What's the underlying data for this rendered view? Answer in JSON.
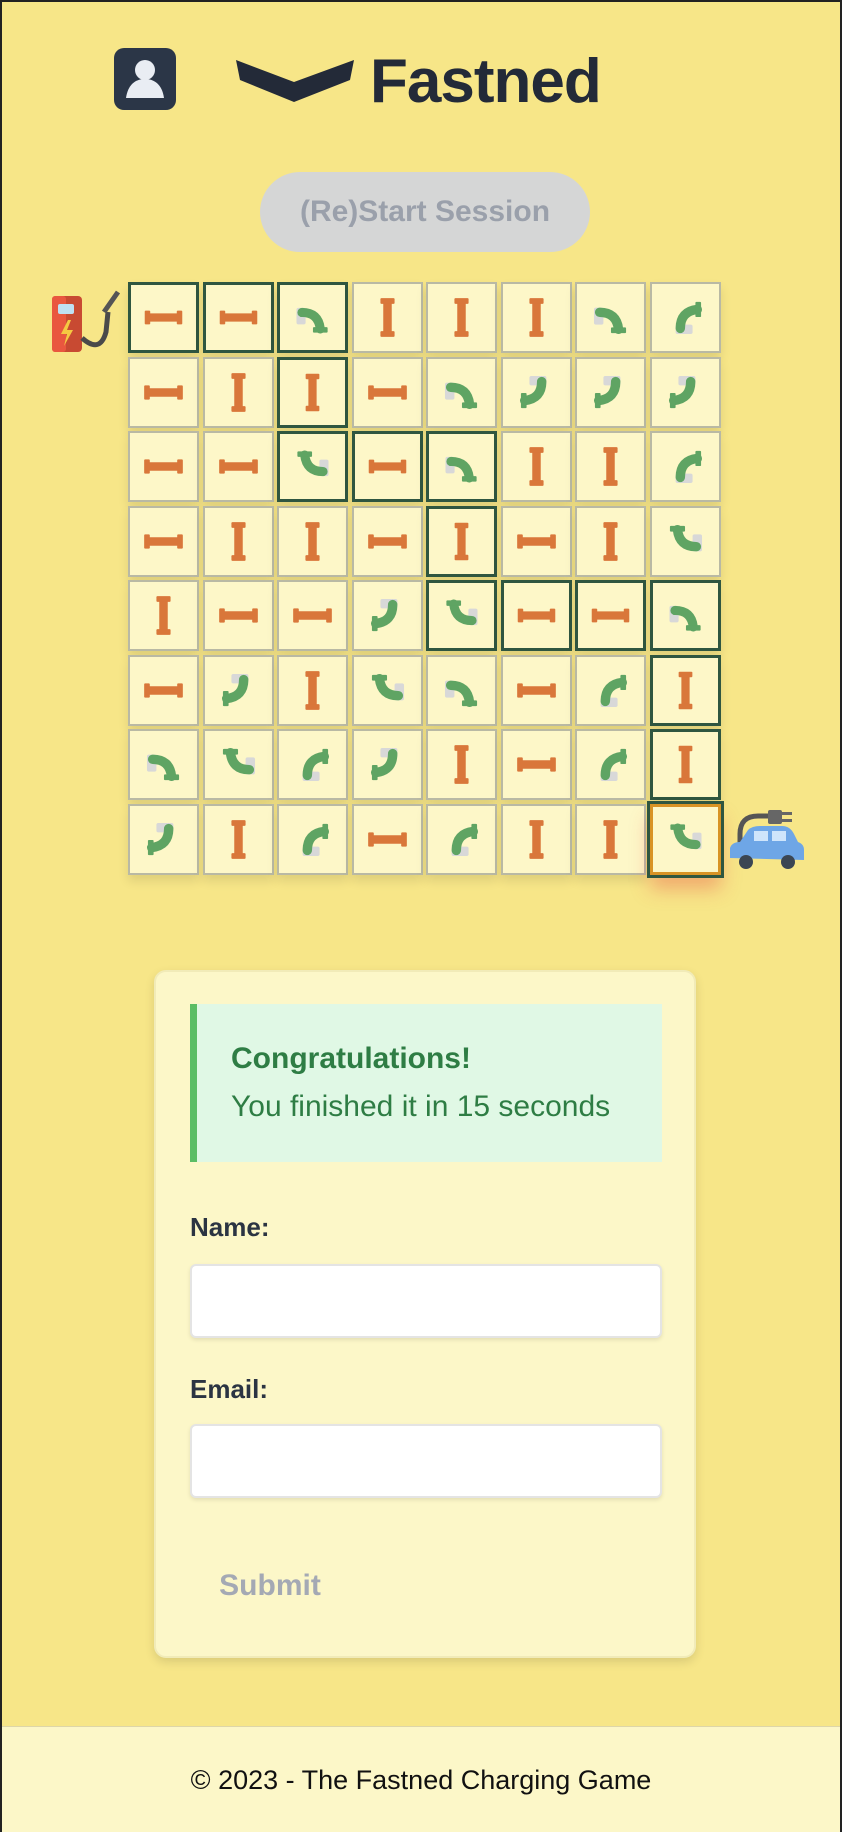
{
  "header": {
    "logo_text": "Fastned",
    "account_icon": "user-icon",
    "logo_icon": "fastned-chevron-icon"
  },
  "controls": {
    "restart_label": "(Re)Start Session"
  },
  "board": {
    "rows": [
      [
        "H",
        "H",
        "CSE",
        "V",
        "V",
        "V",
        "CSE",
        "CNE"
      ],
      [
        "H",
        "V",
        "V",
        "H",
        "CSE",
        "CSW",
        "CSW",
        "CSW"
      ],
      [
        "H",
        "H",
        "CNW",
        "H",
        "CSE",
        "V",
        "V",
        "CNE"
      ],
      [
        "H",
        "V",
        "V",
        "H",
        "V",
        "H",
        "V",
        "CNW"
      ],
      [
        "V",
        "H",
        "H",
        "CSW",
        "CNW",
        "H",
        "H",
        "CSE"
      ],
      [
        "H",
        "CSW",
        "V",
        "CNW",
        "CSE",
        "H",
        "CNE",
        "V"
      ],
      [
        "CSE",
        "CNW",
        "CNE",
        "CSW",
        "V",
        "H",
        "CNE",
        "V"
      ],
      [
        "CSW",
        "V",
        "CNE",
        "H",
        "CNE",
        "V",
        "V",
        "CNW"
      ]
    ],
    "path": [
      [
        0,
        0
      ],
      [
        0,
        1
      ],
      [
        0,
        2
      ],
      [
        1,
        2
      ],
      [
        2,
        2
      ],
      [
        2,
        3
      ],
      [
        2,
        4
      ],
      [
        3,
        4
      ],
      [
        4,
        4
      ],
      [
        4,
        5
      ],
      [
        4,
        6
      ],
      [
        4,
        7
      ],
      [
        5,
        7
      ],
      [
        6,
        7
      ],
      [
        7,
        7
      ]
    ],
    "selected": [
      7,
      7
    ],
    "start_icon": "charging-station-icon",
    "end_icon": "electric-car-icon",
    "colors": {
      "straight_pipe": "#d9773a",
      "bent_pipe": "#5fa463",
      "path_border": "#2f5640"
    }
  },
  "result": {
    "title": "Congratulations!",
    "message": "You finished it in 15 seconds"
  },
  "form": {
    "name_label": "Name:",
    "name_value": "",
    "email_label": "Email:",
    "email_value": "",
    "submit_label": "Submit"
  },
  "footer": {
    "text": "© 2023 - The Fastned Charging Game"
  }
}
